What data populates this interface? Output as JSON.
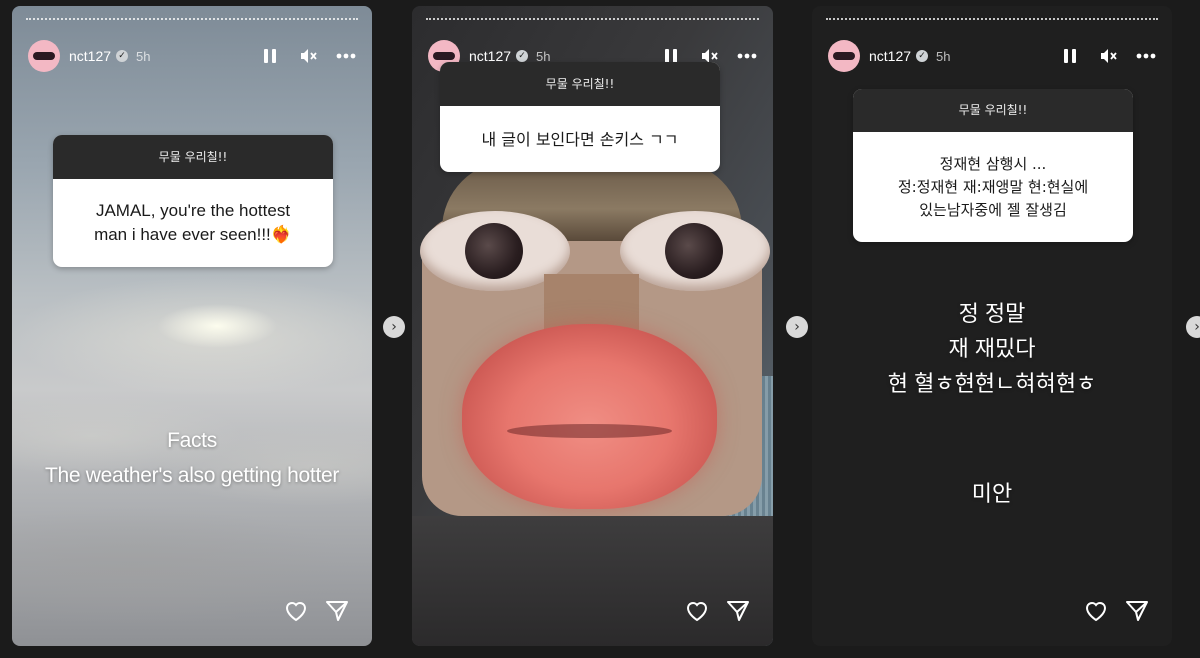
{
  "stories": [
    {
      "username": "nct127",
      "time": "5h",
      "question_header": "무물 우리칠!!",
      "question_lines": [
        "JAMAL, you're the hottest",
        "man i have ever seen!!!❤️‍🔥"
      ],
      "overlay_lines": [
        "Facts",
        "The weather's also getting hotter"
      ]
    },
    {
      "username": "nct127",
      "time": "5h",
      "question_header": "무물 우리칠!!",
      "question_lines": [
        "내 글이 보인다면 손키스 ㄱㄱ"
      ]
    },
    {
      "username": "nct127",
      "time": "5h",
      "question_header": "무물 우리칠!!",
      "question_lines": [
        "정재현 삼행시 ...",
        "정:정재현 재:재앵말 현:현실에",
        "있는남자중에 젤 잘생김"
      ],
      "overlay_lines": [
        "정 정말",
        "재 재밌다",
        "현 혈ㅎ현현ㄴ혀혀현ㅎ"
      ],
      "overlay_sorry": "미안"
    }
  ],
  "icons": {
    "pause": "pause-icon",
    "mute": "mute-icon",
    "more": "more-icon",
    "like": "heart-icon",
    "share": "send-icon",
    "verified": "verified-icon"
  },
  "colors": {
    "avatar_bg": "#f3b8c4",
    "question_header_bg": "#2a2a2a"
  }
}
